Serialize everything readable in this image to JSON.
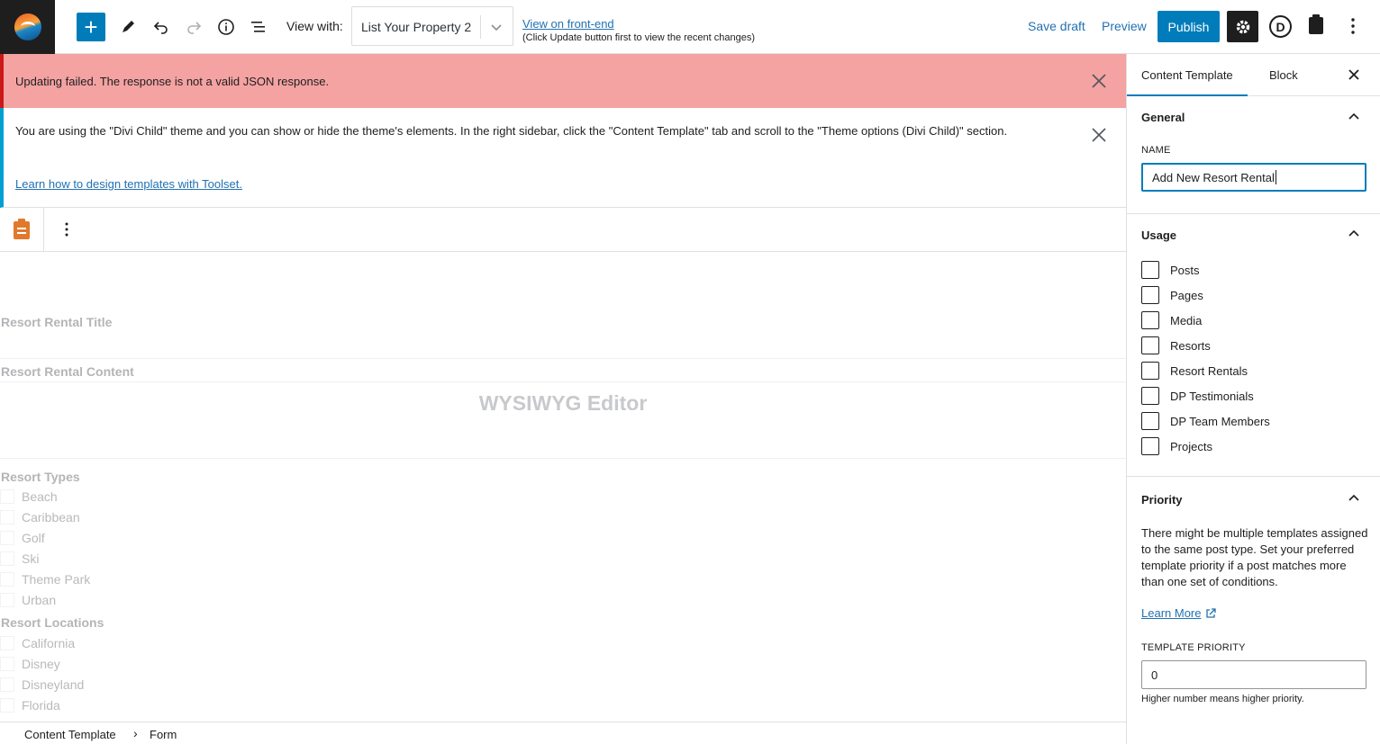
{
  "toolbar": {
    "view_with_label": "View with:",
    "view_with_value": "List Your Property 2",
    "view_frontend_link": "View on front-end",
    "view_frontend_note": "(Click Update button first to view the recent changes)",
    "save_draft": "Save draft",
    "preview": "Preview",
    "publish": "Publish",
    "divi_letter": "D"
  },
  "notices": {
    "error": "Updating failed. The response is not a valid JSON response.",
    "info": "You are using the \"Divi Child\" theme and you can show or hide the theme's elements. In the right sidebar, click the \"Content Template\" tab and scroll to the \"Theme options (Divi Child)\" section.",
    "info_link": "Learn how to design templates with Toolset."
  },
  "form": {
    "title_label": "Resort Rental Title",
    "content_label": "Resort Rental Content",
    "wysiwyg_label": "WYSIWYG Editor",
    "types_label": "Resort Types",
    "types": [
      "Beach",
      "Caribbean",
      "Golf",
      "Ski",
      "Theme Park",
      "Urban"
    ],
    "locations_label": "Resort Locations",
    "locations": [
      "California",
      "Disney",
      "Disneyland",
      "Florida"
    ]
  },
  "breadcrumb": {
    "root": "Content Template",
    "separator": "›",
    "current": "Form"
  },
  "sidebar": {
    "tabs": [
      "Content Template",
      "Block"
    ],
    "general": {
      "title": "General",
      "name_label": "NAME",
      "name_value": "Add New Resort Rental"
    },
    "usage": {
      "title": "Usage",
      "items": [
        "Posts",
        "Pages",
        "Media",
        "Resorts",
        "Resort Rentals",
        "DP Testimonials",
        "DP Team Members",
        "Projects"
      ]
    },
    "priority": {
      "title": "Priority",
      "description": "There might be multiple templates assigned to the same post type. Set your preferred template priority if a post matches more than one set of conditions.",
      "learn_more": "Learn More",
      "template_priority_label": "TEMPLATE PRIORITY",
      "template_priority_value": "0",
      "hint": "Higher number means higher priority."
    }
  }
}
